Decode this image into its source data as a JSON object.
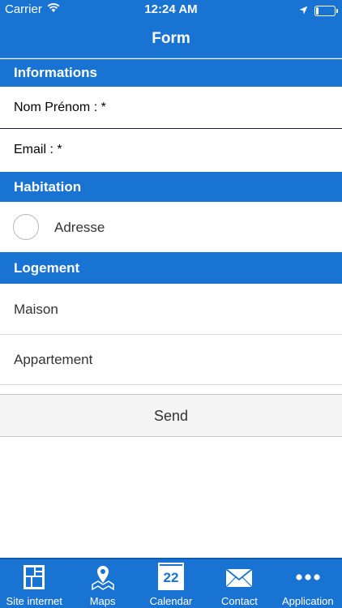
{
  "status_bar": {
    "carrier": "Carrier",
    "time": "12:24 AM",
    "battery_level": 0.15
  },
  "nav": {
    "title": "Form"
  },
  "sections": {
    "informations": "Informations",
    "habitation": "Habitation",
    "logement": "Logement"
  },
  "fields": {
    "nom_prenom": "Nom Prénom : *",
    "email": "Email :  *"
  },
  "habitation": {
    "adresse_label": "Adresse",
    "selected": false
  },
  "logement": {
    "items": [
      "Maison",
      "Appartement"
    ]
  },
  "send": {
    "label": "Send"
  },
  "tabs": [
    {
      "label": "Site internet",
      "icon": "site-internet-icon"
    },
    {
      "label": "Maps",
      "icon": "map-pin-icon"
    },
    {
      "label": "Calendar",
      "icon": "calendar-icon",
      "day": "22"
    },
    {
      "label": "Contact",
      "icon": "envelope-icon"
    },
    {
      "label": "Application",
      "icon": "more-dots-icon"
    }
  ],
  "colors": {
    "primary": "#1873d3",
    "background": "#ffffff",
    "button_bg": "#f4f4f4"
  }
}
